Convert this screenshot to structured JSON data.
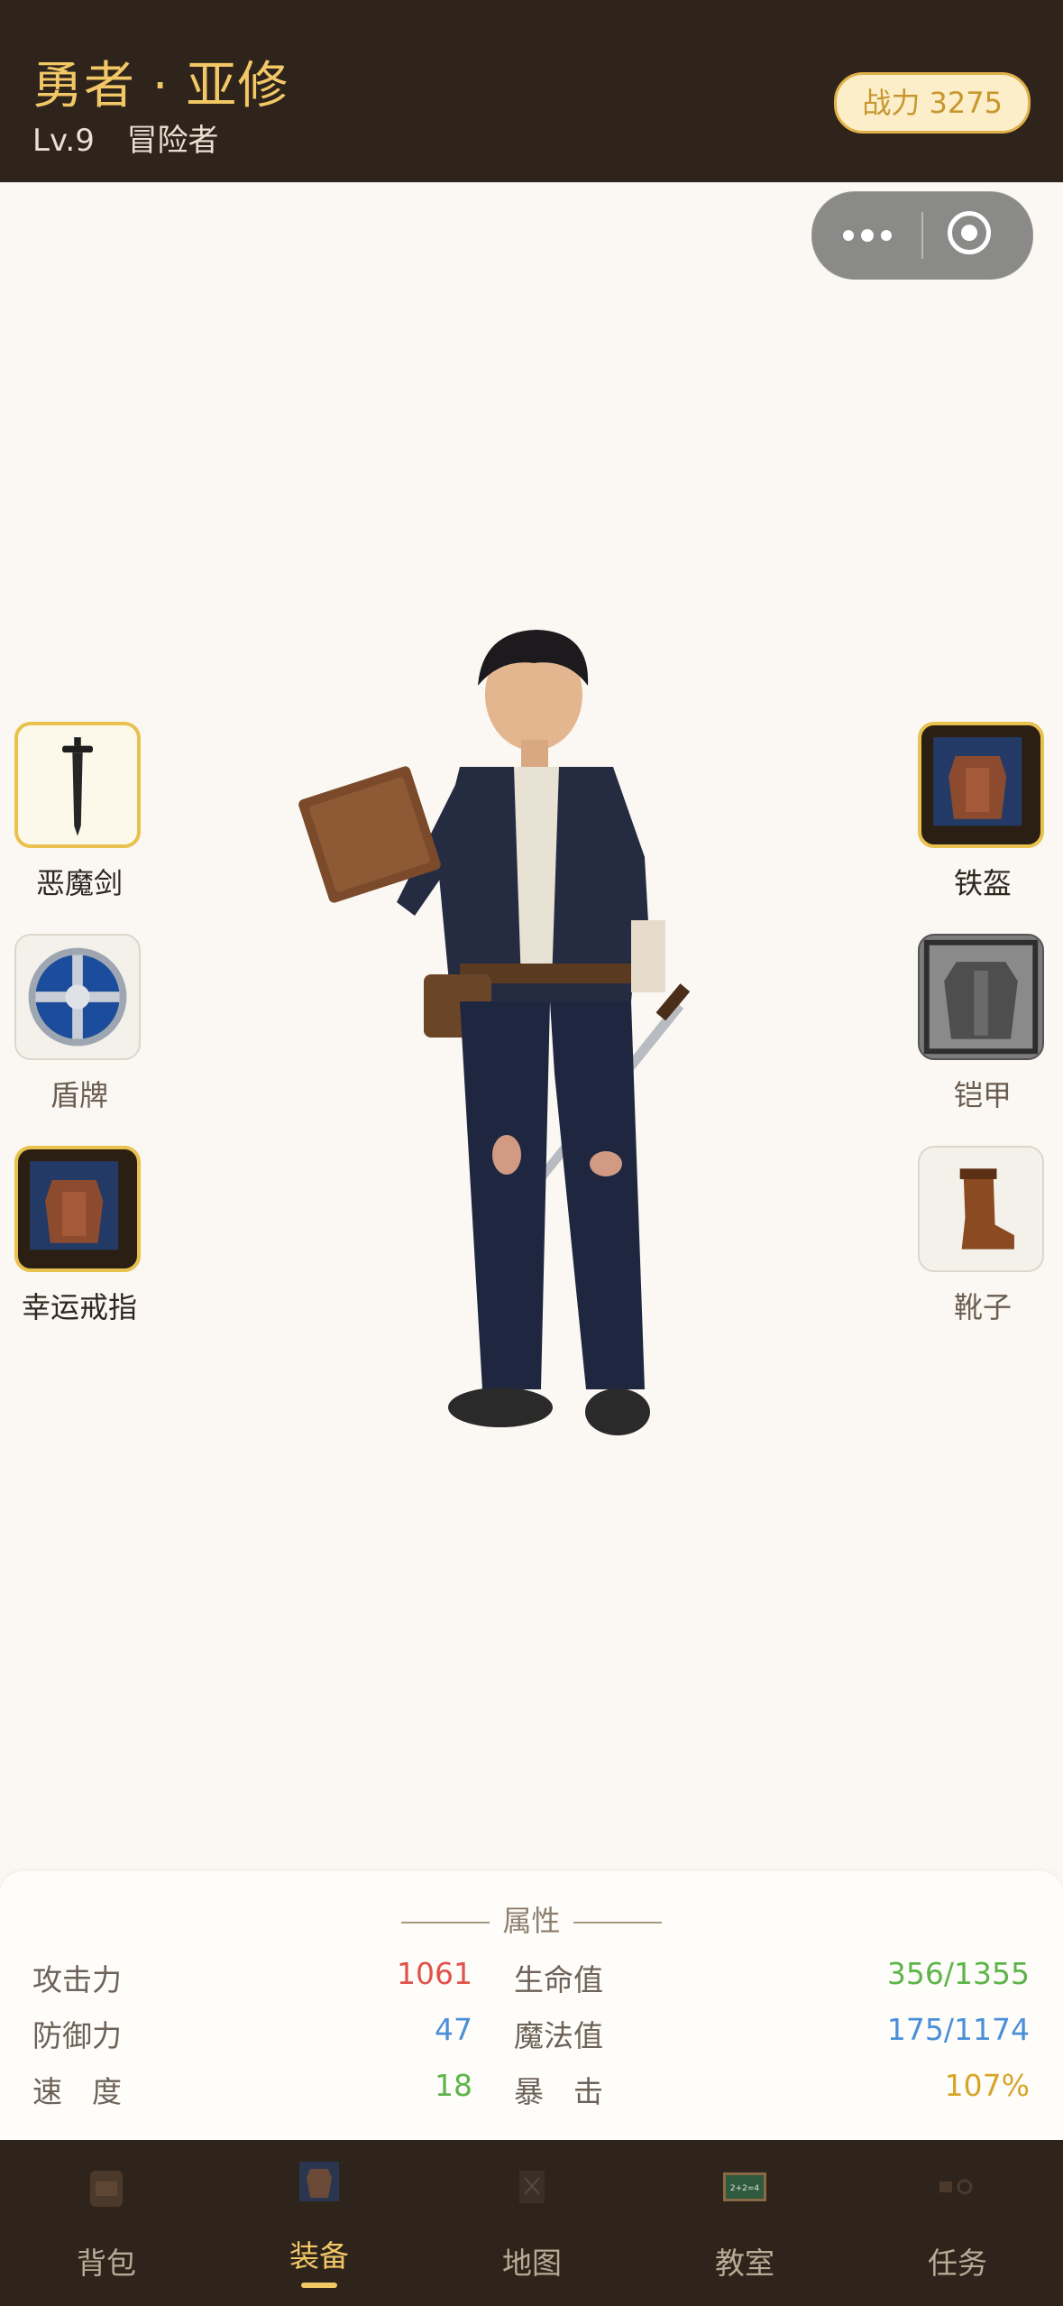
{
  "header": {
    "hero_name": "勇者 · 亚修",
    "level": "Lv.9",
    "class": "冒险者",
    "power_label": "战力 3275"
  },
  "equipment": {
    "left": [
      {
        "label": "恶魔剑",
        "equipped": true,
        "icon": "sword-icon"
      },
      {
        "label": "盾牌",
        "equipped": false,
        "icon": "shield-icon"
      },
      {
        "label": "幸运戒指",
        "equipped": true,
        "icon": "leather-armor-icon"
      }
    ],
    "right": [
      {
        "label": "铁盔",
        "equipped": true,
        "icon": "leather-armor-icon"
      },
      {
        "label": "铠甲",
        "equipped": false,
        "icon": "plate-armor-icon"
      },
      {
        "label": "靴子",
        "equipped": false,
        "icon": "boot-icon"
      }
    ]
  },
  "stats": {
    "title": "属性",
    "attack_label": "攻击力",
    "attack": "1061",
    "defense_label": "防御力",
    "defense": "47",
    "speed_label": "速　度",
    "speed": "18",
    "hp_label": "生命值",
    "hp": "356/1355",
    "mp_label": "魔法值",
    "mp": "175/1174",
    "crit_label": "暴　击",
    "crit": "107%",
    "colors": {
      "attack": "#e0524a",
      "defense": "#4a8fd8",
      "speed": "#5db54a",
      "hp": "#5db54a",
      "mp": "#4a8fd8",
      "crit": "#d6a52a"
    }
  },
  "nav": [
    {
      "label": "背包",
      "icon": "backpack-icon",
      "active": false
    },
    {
      "label": "装备",
      "icon": "equipment-icon",
      "active": true
    },
    {
      "label": "地图",
      "icon": "map-icon",
      "active": false
    },
    {
      "label": "教室",
      "icon": "blackboard-icon",
      "active": false
    },
    {
      "label": "任务",
      "icon": "quest-icon",
      "active": false
    }
  ]
}
